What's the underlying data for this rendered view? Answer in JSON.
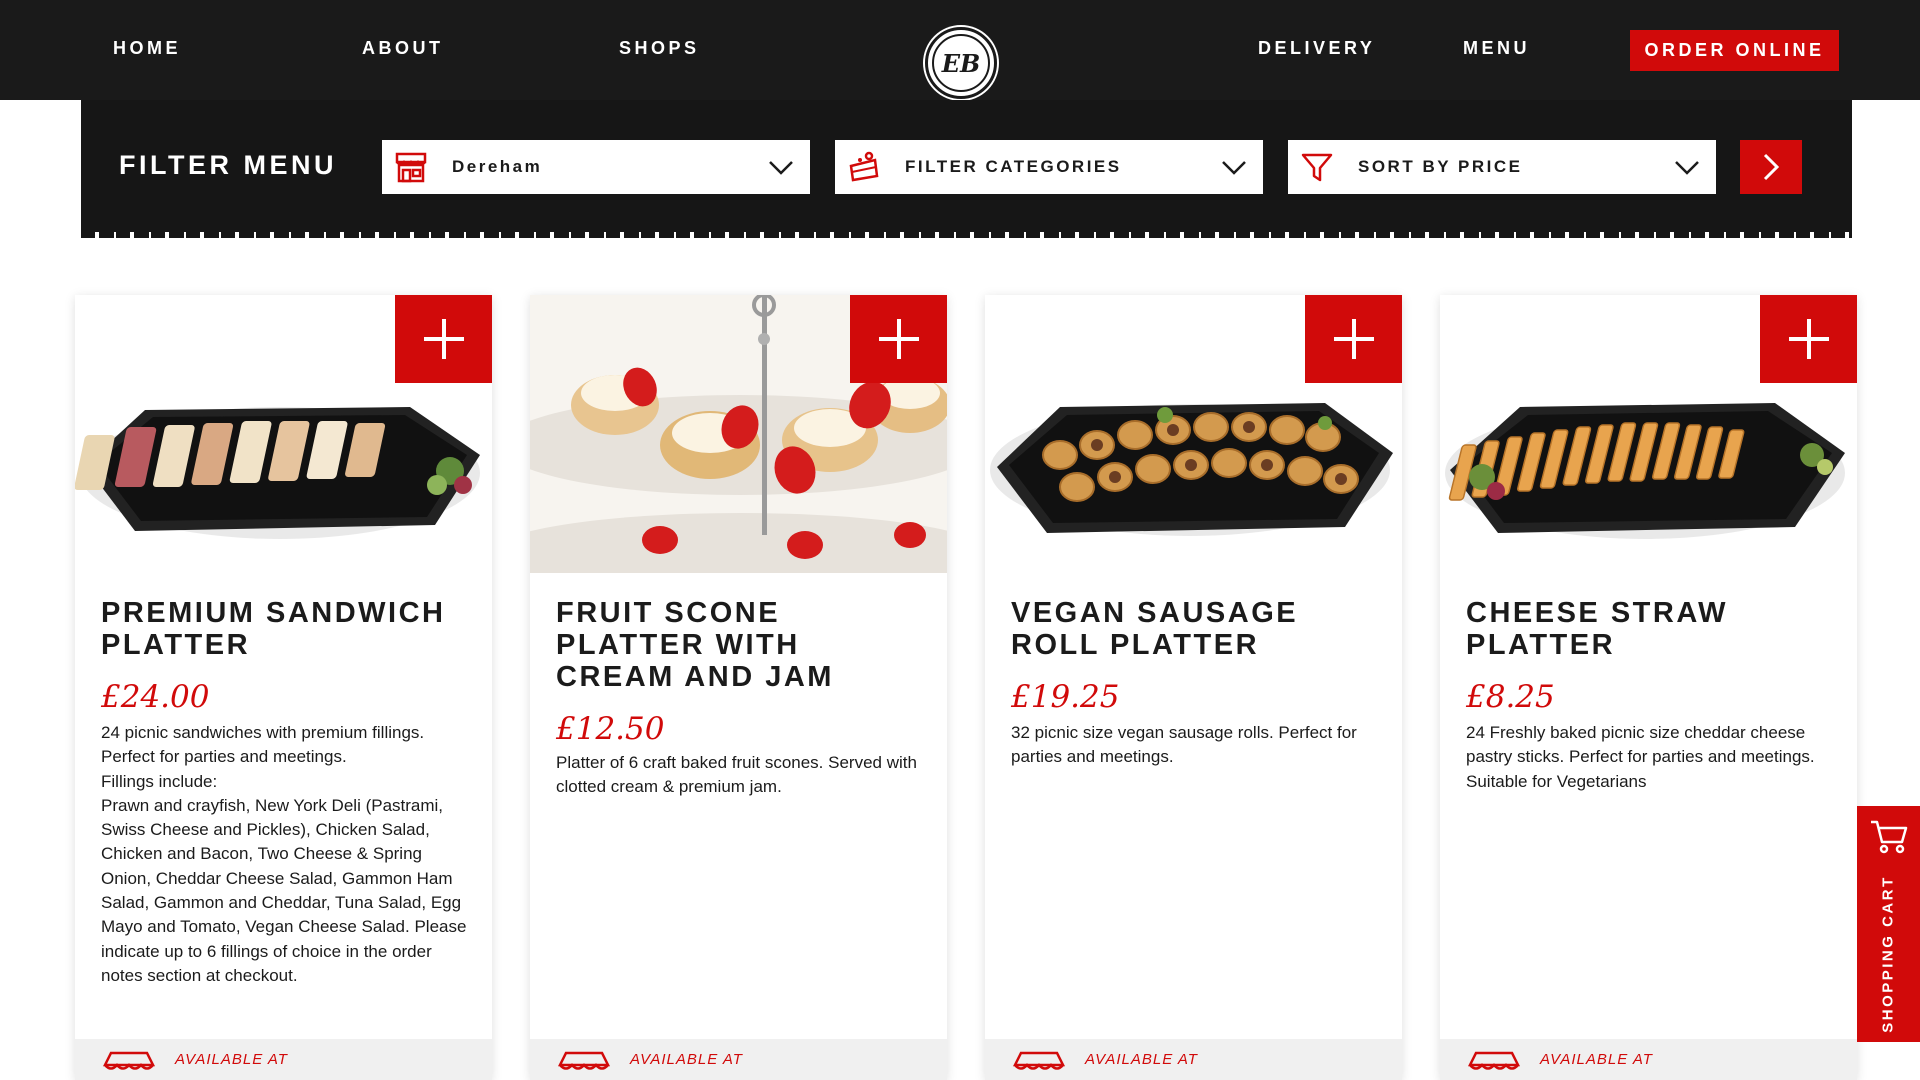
{
  "nav": {
    "links": [
      "HOME",
      "ABOUT",
      "SHOPS",
      "DELIVERY",
      "MENU"
    ],
    "order_label": "ORDER ONLINE",
    "logo_icon": "brand-logo-icon",
    "logo_text": "EB"
  },
  "filter": {
    "title": "FILTER MENU",
    "location": "Dereham",
    "categories": "FILTER CATEGORIES",
    "sort": "SORT BY PRICE",
    "location_icon": "shop-icon",
    "categories_icon": "cake-icon",
    "sort_icon": "funnel-icon",
    "go_icon": "chevron-right-icon"
  },
  "products": [
    {
      "title": "PREMIUM SANDWICH PLATTER",
      "price": "£24.00",
      "description": "24 picnic sandwiches with premium fillings.\nPerfect for parties and meetings.\nFillings include:\nPrawn and crayfish, New York Deli (Pastrami, Swiss Cheese and Pickles), Chicken Salad, Chicken and Bacon, Two Cheese & Spring Onion, Cheddar Cheese Salad, Gammon Ham Salad, Gammon and Cheddar, Tuna Salad, Egg Mayo and Tomato, Vegan Cheese Salad. Please indicate up to 6 fillings of choice in the order notes section at checkout.",
      "availability": "AVAILABLE AT"
    },
    {
      "title": "FRUIT SCONE PLATTER WITH CREAM AND JAM",
      "price": "£12.50",
      "description": "Platter of 6 craft baked fruit scones. Served with clotted cream & premium jam.",
      "availability": "AVAILABLE AT"
    },
    {
      "title": "VEGAN SAUSAGE ROLL PLATTER",
      "price": "£19.25",
      "description": "32 picnic size vegan sausage rolls. Perfect for parties and meetings.",
      "availability": "AVAILABLE AT"
    },
    {
      "title": "CHEESE STRAW PLATTER",
      "price": "£8.25",
      "description": "24 Freshly baked picnic size cheddar cheese pastry sticks. Perfect for parties and meetings.\nSuitable for Vegetarians",
      "availability": "AVAILABLE AT"
    }
  ],
  "cart": {
    "label": "SHOPPING CART",
    "icon": "cart-icon"
  },
  "colors": {
    "accent": "#d10a0a",
    "nav_bg": "#1a1a1a",
    "filter_bg": "#161616",
    "footer_bg": "#f0f0f0"
  }
}
